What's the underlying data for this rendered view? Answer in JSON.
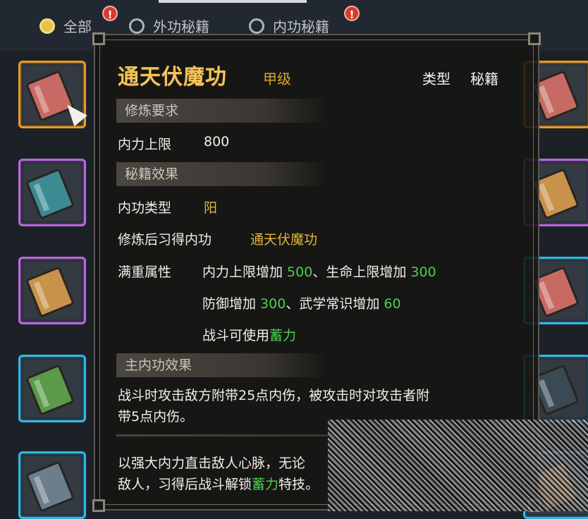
{
  "filters": [
    {
      "label": "全部",
      "selected": true,
      "alert": "!"
    },
    {
      "label": "外功秘籍",
      "selected": false,
      "alert": ""
    },
    {
      "label": "内功秘籍",
      "selected": false,
      "alert": "!"
    }
  ],
  "slots": [
    {
      "icon": "red-book-icon",
      "rarity": "orange",
      "selected": true
    },
    {
      "icon": "teal-book-icon",
      "rarity": "purple"
    },
    {
      "icon": "tan-book-icon",
      "rarity": "purple"
    },
    {
      "icon": "green-book-icon",
      "rarity": "blue"
    },
    {
      "icon": "slate-book-icon",
      "rarity": "blue"
    }
  ],
  "tooltip": {
    "name": "通天伏魔功",
    "grade": "甲级",
    "type_label": "类型",
    "type_value": "秘籍",
    "requirements": {
      "header": "修炼要求",
      "label": "内力上限",
      "value": "800"
    },
    "effects": {
      "header": "秘籍效果",
      "neigong_type_label": "内功类型",
      "neigong_type_value": "阳",
      "learn_label": "修炼后习得内功",
      "learn_value": "通天伏魔功",
      "attr_label": "满重属性",
      "attr_line1": {
        "a": "内力上限增加 ",
        "av": "500",
        "sep": "、生命上限增加 ",
        "bv": "300"
      },
      "attr_line2": {
        "a": "防御增加 ",
        "av": "300",
        "sep": "、武学常识增加 ",
        "bv": "60"
      },
      "attr_line3": {
        "a": "战斗可使用",
        "av": "蓄力"
      }
    },
    "main_effect": {
      "header": "主内功效果",
      "line1": "战斗时攻击敌方附带25点内伤，被攻击时对攻击者附",
      "line2": "带5点内伤。"
    },
    "description": {
      "line1": "以强大内力直击敌人心脉，无论",
      "line2a": "敌人，习得后战斗解锁",
      "line2b": "蓄力",
      "line2c": "特技。"
    }
  }
}
